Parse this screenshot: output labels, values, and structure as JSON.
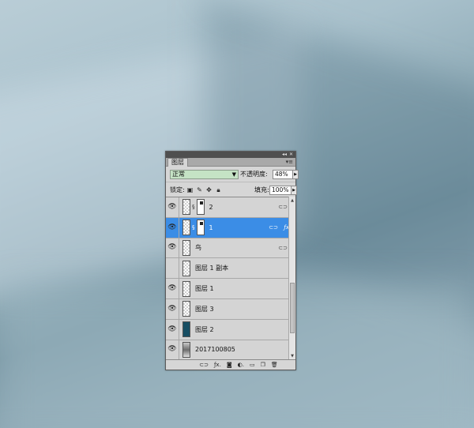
{
  "panel": {
    "tab_label": "图层",
    "blend_mode": "正常",
    "opacity_label": "不透明度:",
    "opacity_value": "48%",
    "lock_label": "锁定:",
    "fill_label": "填充:",
    "fill_value": "100%"
  },
  "layers": [
    {
      "name": "2",
      "visible": true,
      "selected": false
    },
    {
      "name": "1",
      "visible": true,
      "selected": true
    },
    {
      "name": "鸟",
      "visible": true,
      "selected": false
    },
    {
      "name": "图层 1 副本",
      "visible": false,
      "selected": false
    },
    {
      "name": "图层 1",
      "visible": true,
      "selected": false
    },
    {
      "name": "图层 3",
      "visible": true,
      "selected": false
    },
    {
      "name": "图层 2",
      "visible": true,
      "selected": false
    },
    {
      "name": "2017100805",
      "visible": true,
      "selected": false
    }
  ],
  "colors": {
    "selection": "#3b8de6",
    "blend_field": "#c5e3c5",
    "layer2_fill": "#174e63"
  }
}
